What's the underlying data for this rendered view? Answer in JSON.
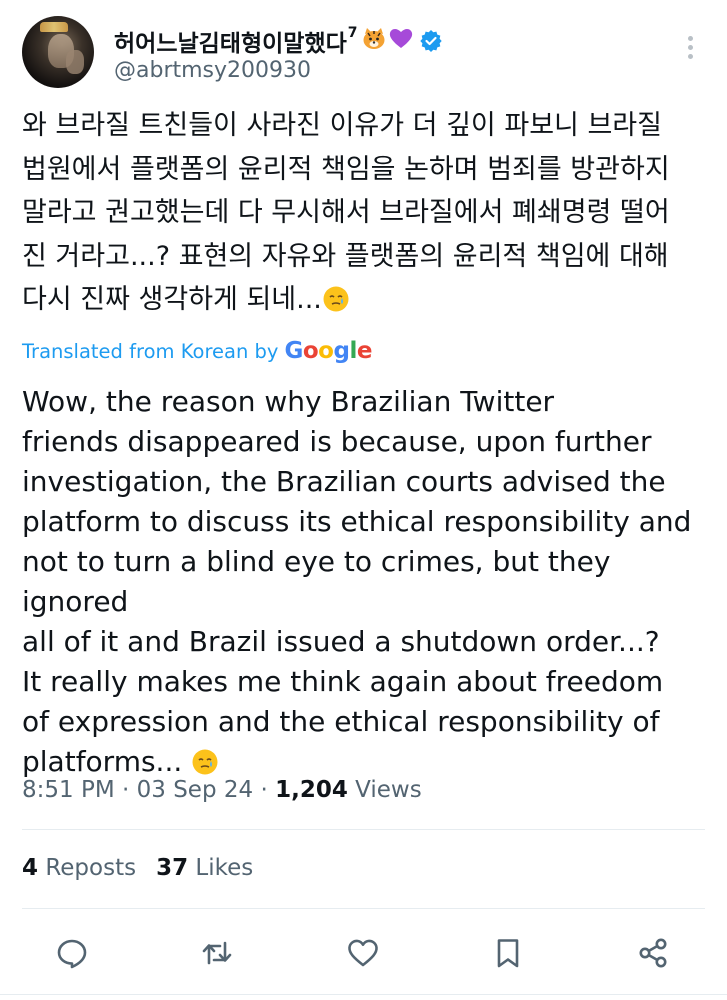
{
  "author": {
    "display_name": "허어느날김태형이말했다",
    "display_name_sup": "7",
    "display_name_emojis": [
      "tiger-face-emoji",
      "purple-heart-emoji"
    ],
    "handle": "@abrtmsy200930",
    "verified": true
  },
  "tweet": {
    "text_korean": "와 브라질 트친들이 사라진 이유가 더 깊이 파보니 브라질\n법원에서 플랫폼의 윤리적 책임을 논하며 범죄를 방관하지\n말라고 권고했는데 다 무시해서 브라질에서 폐쇄명령 떨어\n진 거라고...? 표현의 자유와 플랫폼의 윤리적 책임에 대해\n다시 진짜  생각하게 되네...",
    "translated_from_label": "Translated from Korean by",
    "translator_brand": "Google",
    "text_english": "Wow, the reason why Brazilian Twitter\nfriends disappeared is because, upon further\ninvestigation, the Brazilian courts advised the\nplatform to discuss its ethical responsibility and\nnot to turn a blind eye to crimes, but they ignored\nall of it and Brazil issued a shutdown order...?\nIt really makes me think again about freedom\nof expression and the ethical responsibility of\nplatforms... "
  },
  "meta": {
    "time": "8:51 PM",
    "sep1": " · ",
    "date": "03 Sep 24",
    "sep2": " · ",
    "views_count": "1,204",
    "views_label": " Views"
  },
  "stats": {
    "reposts_count": "4",
    "reposts_label": " Reposts",
    "likes_count": "37",
    "likes_label": " Likes"
  },
  "actions": [
    "reply-icon",
    "repost-icon",
    "like-icon",
    "bookmark-icon",
    "share-icon"
  ],
  "colors": {
    "link_blue": "#1d9bf0",
    "secondary_text": "#536471",
    "primary_text": "#0f1419",
    "action_icon": "#536471"
  }
}
